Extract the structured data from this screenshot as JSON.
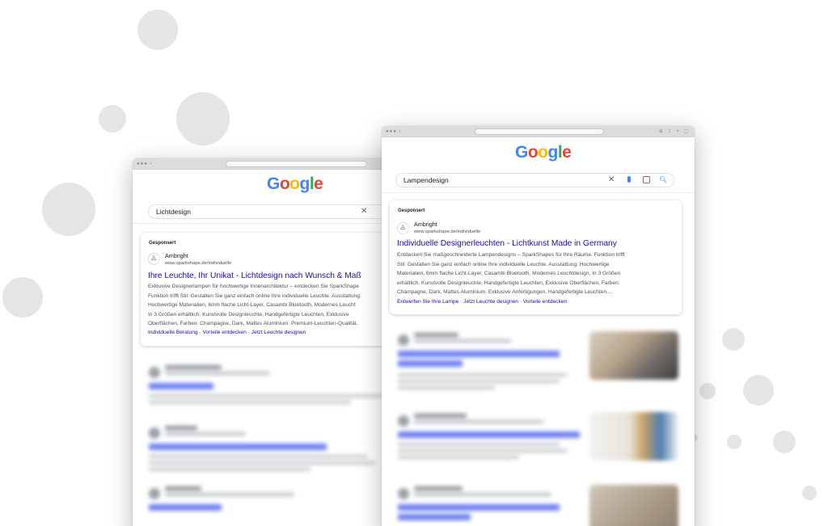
{
  "colors": {
    "link_blue": "#1a0dab",
    "text_grey": "#4d5156",
    "bubble_grey": "#e5e5e5",
    "google_blue": "#4285f4",
    "google_red": "#ea4335",
    "google_yellow": "#fbbc05",
    "google_green": "#34a853"
  },
  "logo": {
    "g1": "G",
    "o1": "o",
    "o2": "o",
    "g2": "g",
    "l": "l",
    "e": "e"
  },
  "back_window": {
    "query": "Lichtdesign",
    "ad": {
      "sponsored": "Gesponsert",
      "advertiser": "Ambright",
      "display_url": "www.sparkshape.de/individuelle",
      "title": "Ihre Leuchte, Ihr Unikat - Lichtdesign nach Wunsch & Maß",
      "description": [
        "Exklusive Designerlampen für hochwertige Innenarchitektur – entdecken Sie SparkShape",
        "Funktion trifft Stil: Gestalten Sie ganz einfach online Ihre individuelle Leuchte. Ausstattung:",
        "Hochwertige Materialien, 6mm flache Licht-Layer, Casambi Bluetooth, Modernes Leucht",
        "In 3 Größen erhältlich, Kunstvolle Designleuchte, Handgefertigte Leuchten, Exklusive",
        "Oberflächen, Farben: Champagne, Dark, Mattes Aluminium. Premium-Leuchten-Qualität."
      ],
      "sitelinks": [
        "Individuelle Beratung",
        "Vorteile entdecken",
        "Jetzt Leuchte designen"
      ],
      "separator": "·"
    }
  },
  "front_window": {
    "query": "Lampendesign",
    "ad": {
      "sponsored": "Gesponsert",
      "advertiser": "Ambright",
      "display_url": "www.sparkshape.de/individuelle",
      "title": "Individuelle Designerleuchten - Lichtkunst Made in Germany",
      "description": [
        "Entdecken Sie maßgeschneiderte Lampendesigns – SparkShapes für Ihre Räume. Funktion trifft",
        "Stil: Gestalten Sie ganz einfach online Ihre individuelle Leuchte. Ausstattung: Hochwertige",
        "Materialien, 6mm flache Licht-Layer, Casambi Bluetooth, Modernes Leuchtdesign, In 3 Größen",
        "erhältlich, Kunstvolle Designleuchte, Handgefertigte Leuchten, Exklusive Oberflächen, Farben:",
        "Champagne, Dark, Mattes Aluminium. Exklusive Anfertigungen. Handgefertigte Leuchten...."
      ],
      "sitelinks": [
        "Entwerfen Sie Ihre Lampe",
        "Jetzt Leuchte designen",
        "Vorteile entdecken"
      ],
      "separator": "·"
    }
  }
}
